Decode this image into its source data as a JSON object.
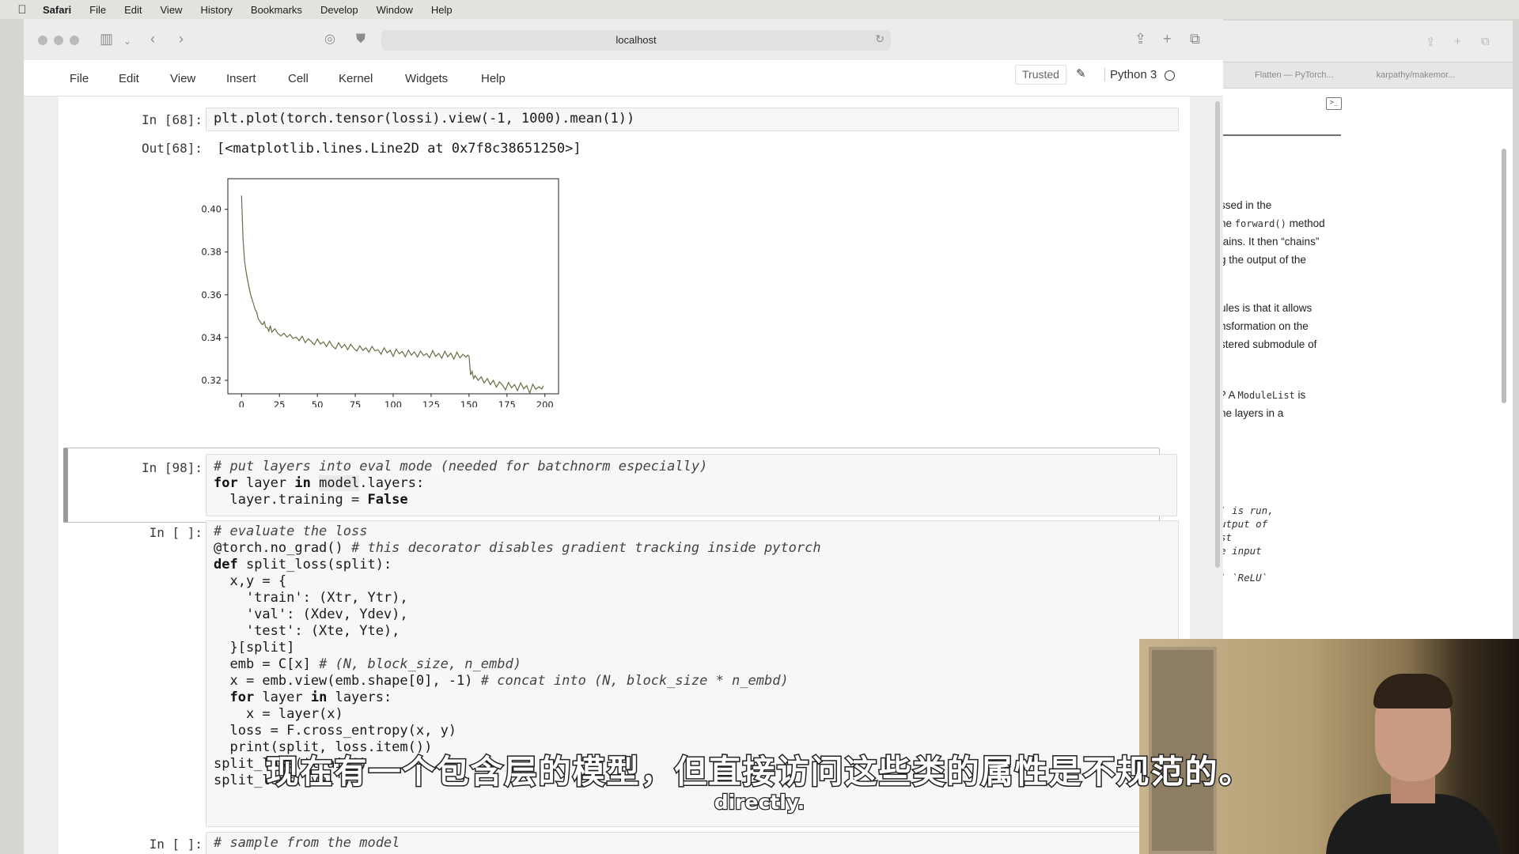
{
  "menubar": {
    "items": [
      "Safari",
      "File",
      "Edit",
      "View",
      "History",
      "Bookmarks",
      "Develop",
      "Window",
      "Help"
    ]
  },
  "browser": {
    "url": "localhost",
    "icons": [
      "sidebar-icon",
      "back-icon",
      "forward-icon",
      "extension-icon",
      "shield-icon",
      "reload-icon",
      "share-icon",
      "new-tab-icon",
      "tab-overview-icon"
    ]
  },
  "jupyter": {
    "menu": [
      "File",
      "Edit",
      "View",
      "Insert",
      "Cell",
      "Kernel",
      "Widgets",
      "Help"
    ],
    "trusted": "Trusted",
    "kernel_name": "Python 3"
  },
  "cells": {
    "c68": {
      "in_prompt": "In [68]:",
      "code": "plt.plot(torch.tensor(lossi).view(-1, 1000).mean(1))",
      "out_prompt": "Out[68]:",
      "out_text": "[<matplotlib.lines.Line2D at 0x7f8c38651250>]"
    },
    "c98": {
      "in_prompt": "In [98]:",
      "line1_comment": "# put layers into eval mode (needed for batchnorm especially)",
      "line2_kw1": "for",
      "line2_a": " layer ",
      "line2_kw2": "in",
      "line2_hl": "model",
      "line2_b": ".layers:",
      "line3_a": "  layer.training = ",
      "line3_kw": "False"
    },
    "eval": {
      "in_prompt": "In [ ]:",
      "l1_comment": "# evaluate the loss",
      "l2_code": "@torch.no_grad() ",
      "l2_comment": "# this decorator disables gradient tracking inside pytorch",
      "l3_kw": "def",
      "l3_code": " split_loss(split):",
      "l4": "  x,y = {",
      "l5": "    'train': (Xtr, Ytr),",
      "l6": "    'val': (Xdev, Ydev),",
      "l7": "    'test': (Xte, Yte),",
      "l8": "  }[split]",
      "l9_code": "  emb = C[x] ",
      "l9_comment": "# (N, block_size, n_embd)",
      "l10_code": "  x = emb.view(emb.shape[0], -1) ",
      "l10_comment": "# concat into (N, block_size * n_embd)",
      "l11_kw1": "for",
      "l11_a": " layer ",
      "l11_kw2": "in",
      "l11_b": " layers:",
      "l12": "    x = layer(x)",
      "l13": "  loss = F.cross_entropy(x, y)",
      "l14": "  print(split, loss.item())",
      "l15": "split_loss('train')",
      "l16": "split_loss('val')"
    },
    "sample": {
      "in_prompt": "In [ ]:",
      "l1_comment": "# sample from the model"
    }
  },
  "chart_data": {
    "type": "line",
    "xlim": [
      -9,
      209
    ],
    "ylim": [
      0.3137,
      0.4143
    ],
    "xticks": [
      0,
      25,
      50,
      75,
      100,
      125,
      150,
      175,
      200
    ],
    "yticks": [
      0.32,
      0.34,
      0.36,
      0.38,
      0.4
    ],
    "ytick_labels": [
      "0.32",
      "0.34",
      "0.36",
      "0.38",
      "0.40"
    ],
    "grid": false,
    "color": "#6b6b47",
    "x": [
      0,
      1,
      2,
      3,
      4,
      5,
      6,
      7,
      8,
      9,
      10,
      11,
      12,
      13,
      14,
      15,
      16,
      17,
      18,
      19,
      20,
      22,
      24,
      26,
      28,
      30,
      32,
      34,
      36,
      38,
      40,
      42,
      44,
      46,
      48,
      50,
      52,
      54,
      56,
      58,
      60,
      62,
      64,
      66,
      68,
      70,
      72,
      74,
      76,
      78,
      80,
      82,
      84,
      86,
      88,
      90,
      92,
      94,
      96,
      98,
      100,
      102,
      104,
      106,
      108,
      110,
      112,
      114,
      116,
      118,
      120,
      122,
      124,
      126,
      128,
      130,
      132,
      134,
      136,
      138,
      140,
      142,
      144,
      146,
      148,
      149,
      150,
      151,
      152,
      153,
      154,
      156,
      158,
      160,
      162,
      164,
      166,
      168,
      170,
      172,
      174,
      176,
      178,
      180,
      182,
      184,
      186,
      188,
      190,
      192,
      194,
      196,
      198,
      199
    ],
    "y": [
      0.4064,
      0.386,
      0.3759,
      0.371,
      0.367,
      0.3634,
      0.36,
      0.3578,
      0.3555,
      0.3531,
      0.352,
      0.3488,
      0.3478,
      0.3466,
      0.346,
      0.3475,
      0.3448,
      0.3446,
      0.343,
      0.3456,
      0.3425,
      0.3441,
      0.3419,
      0.3408,
      0.342,
      0.3402,
      0.3414,
      0.3396,
      0.3402,
      0.3385,
      0.3406,
      0.3376,
      0.3394,
      0.3382,
      0.3366,
      0.3393,
      0.337,
      0.338,
      0.3358,
      0.3383,
      0.336,
      0.3347,
      0.3376,
      0.3352,
      0.3368,
      0.3343,
      0.3369,
      0.335,
      0.3337,
      0.3361,
      0.334,
      0.3352,
      0.3332,
      0.3359,
      0.3338,
      0.3343,
      0.3322,
      0.3352,
      0.3329,
      0.334,
      0.3312,
      0.3346,
      0.3324,
      0.3335,
      0.331,
      0.3341,
      0.3318,
      0.3333,
      0.3309,
      0.3337,
      0.3316,
      0.3325,
      0.3306,
      0.3339,
      0.3312,
      0.3326,
      0.3303,
      0.3336,
      0.331,
      0.3327,
      0.3299,
      0.3331,
      0.3305,
      0.3322,
      0.3308,
      0.3318,
      0.3313,
      0.3225,
      0.3242,
      0.3208,
      0.3222,
      0.32,
      0.3216,
      0.3188,
      0.3208,
      0.318,
      0.32,
      0.3168,
      0.3193,
      0.3178,
      0.3155,
      0.319,
      0.3165,
      0.318,
      0.3152,
      0.3188,
      0.316,
      0.3175,
      0.314,
      0.3182,
      0.3158,
      0.317,
      0.316,
      0.3175
    ]
  },
  "bgwin": {
    "tabs": [
      "Flatten — PyTorch...",
      "karpathy/makemor..."
    ],
    "lines": [
      "ssed in the",
      "he ",
      "forward()",
      " method",
      "tains. It then “chains”",
      "g the output of the",
      "ules is that it allows",
      "nsformation on the",
      "stered submodule of",
      "? A ",
      "ModuleList",
      " is",
      "he layers in a"
    ],
    "mono_lines": [
      "` is run,",
      "utput of",
      "st",
      "e input",
      "` `ReLU`"
    ]
  },
  "subtitles": {
    "zh": "现在有一个包含层的模型，但直接访问这些类的属性是不规范的。",
    "en": "directly."
  }
}
